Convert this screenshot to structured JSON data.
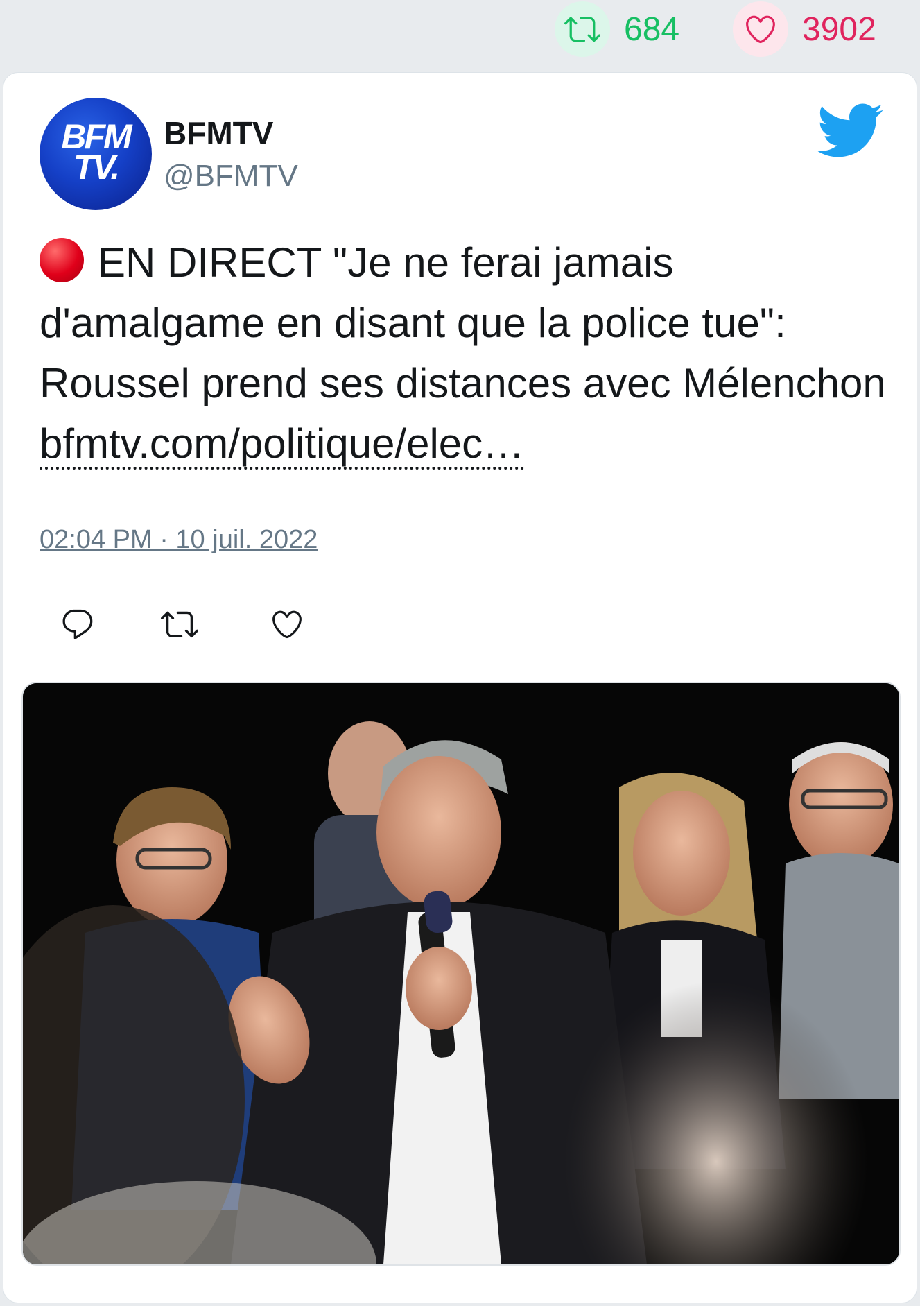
{
  "stats": {
    "retweets": "684",
    "likes": "3902",
    "retweet_icon": "retweet-icon",
    "like_icon": "heart-icon"
  },
  "tweet": {
    "author_name": "BFMTV",
    "author_handle": "@BFMTV",
    "avatar_logo": "BFM TV.",
    "platform_icon": "twitter-bird-icon",
    "text_before_link": "EN DIRECT \"Je ne ferai jamais d'amalgame en disant que la police tue\": Roussel prend ses distances avec Mélenchon ",
    "link_text": "bfmtv.com/politique/elec…",
    "timestamp": "02:04 PM · 10 juil. 2022",
    "actions": [
      "reply-icon",
      "retweet-icon",
      "like-icon"
    ]
  },
  "colors": {
    "background": "#e8ebee",
    "retweet_green": "#17bf63",
    "like_red": "#e0245e",
    "twitter_blue": "#1da1f2",
    "muted_text": "#657786"
  }
}
